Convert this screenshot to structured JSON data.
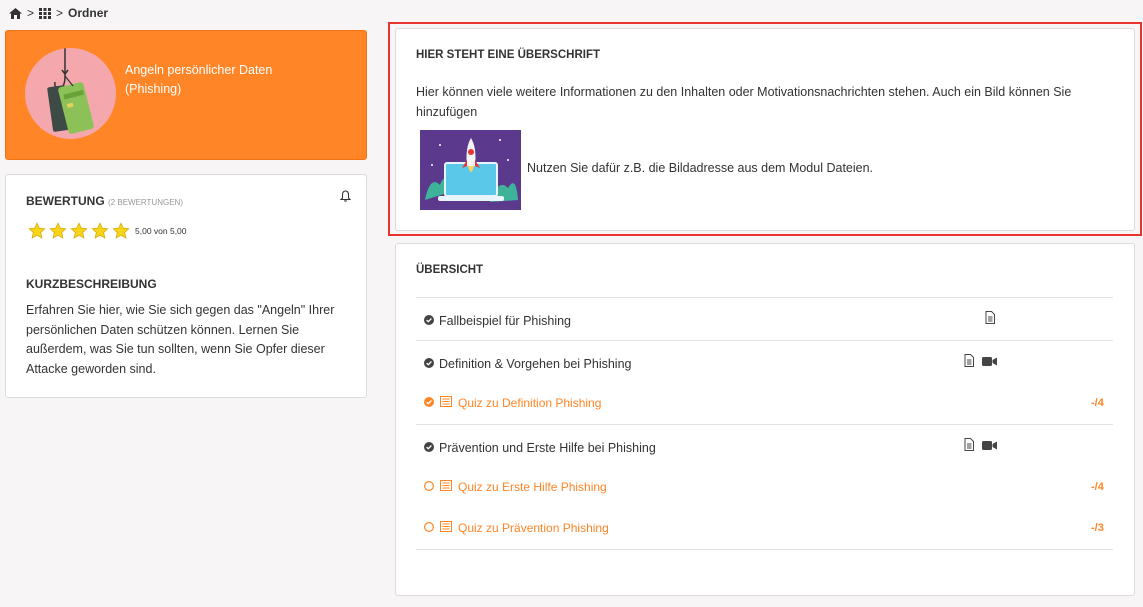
{
  "breadcrumb": {
    "separator": ">",
    "current": "Ordner"
  },
  "course": {
    "title": "Angeln persönlicher Daten (Phishing)",
    "accent_color": "#ff8527"
  },
  "rating": {
    "heading": "BEWERTUNG",
    "count_label": "(2 BEWERTUNGEN)",
    "stars": 5,
    "max_stars": 5,
    "text": "5,00 von 5,00"
  },
  "description": {
    "heading": "KURZBESCHREIBUNG",
    "text": "Erfahren Sie hier, wie Sie sich gegen das \"Angeln\" Ihrer persönlichen Daten schützen können. Lernen Sie außerdem, was Sie tun sollten, wenn Sie Opfer dieser Attacke geworden sind."
  },
  "motivation": {
    "title": "HIER STEHT EINE ÜBERSCHRIFT",
    "body": "Hier können viele weitere Informationen zu den Inhalten oder Motivationsnachrichten stehen. Auch ein Bild können Sie hinzufügen",
    "caption": "Nutzen Sie dafür z.B. die Bildadresse aus dem Modul Dateien."
  },
  "overview": {
    "title": "ÜBERSICHT",
    "items": [
      {
        "label": "Fallbeispiel für Phishing",
        "icons": [
          "document-icon"
        ]
      },
      {
        "label": "Definition & Vorgehen bei Phishing",
        "icons": [
          "document-icon",
          "video-icon"
        ]
      },
      {
        "label": "Prävention und Erste Hilfe bei Phishing",
        "icons": [
          "document-icon",
          "video-icon"
        ]
      }
    ],
    "quizzes": [
      {
        "label": "Quiz zu Definition Phishing",
        "score": "-/4",
        "done": true
      },
      {
        "label": "Quiz zu Erste Hilfe Phishing",
        "score": "-/4",
        "done": false
      },
      {
        "label": "Quiz zu Prävention Phishing",
        "score": "-/3",
        "done": false
      }
    ]
  },
  "colors": {
    "accent": "#ff8527",
    "highlight_border": "#e8332f",
    "text": "#333333"
  }
}
